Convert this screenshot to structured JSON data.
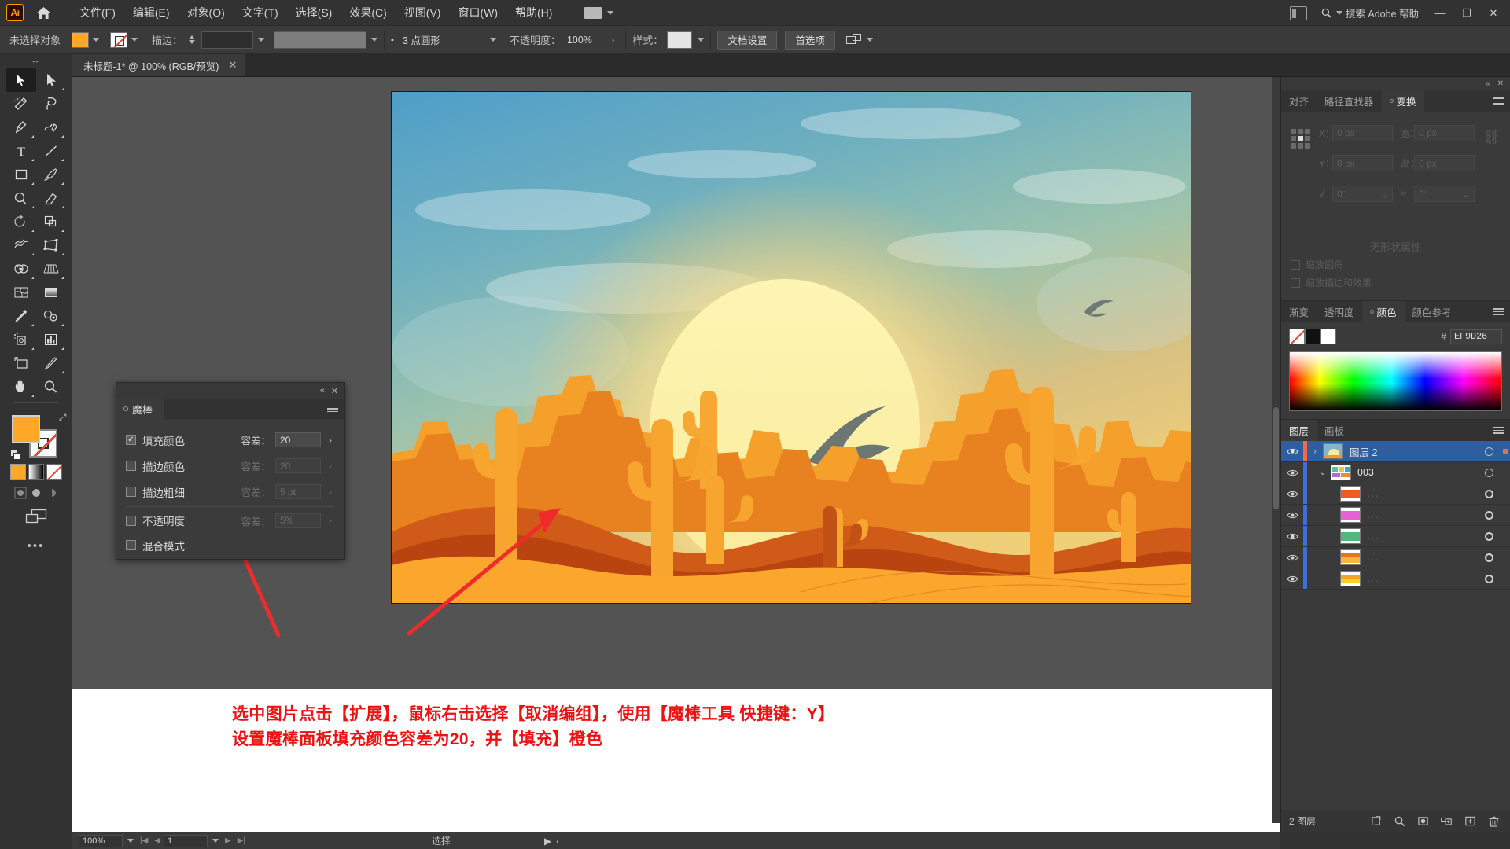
{
  "app": {
    "logo_text": "Ai",
    "home_icon": "home-icon"
  },
  "menubar": {
    "items": [
      {
        "label": "文件(F)"
      },
      {
        "label": "编辑(E)"
      },
      {
        "label": "对象(O)"
      },
      {
        "label": "文字(T)"
      },
      {
        "label": "选择(S)"
      },
      {
        "label": "效果(C)"
      },
      {
        "label": "视图(V)"
      },
      {
        "label": "窗口(W)"
      },
      {
        "label": "帮助(H)"
      }
    ],
    "search_placeholder": "搜索 Adobe 帮助",
    "minimize": "—",
    "restore": "❐",
    "close": "✕"
  },
  "controlbar": {
    "selection_status": "未选择对象",
    "fill_color": "#FFA727",
    "stroke_label": "描边：",
    "stroke_weight": "",
    "stroke_profile_label": "3 点圆形",
    "opacity_label": "不透明度：",
    "opacity_value": "100%",
    "style_label": "样式：",
    "doc_setup_label": "文档设置",
    "preferences_label": "首选项",
    "arrange_icon": "arrange-documents-icon"
  },
  "document_tab": {
    "title": "未标题-1* @ 100% (RGB/预览)",
    "close": "✕"
  },
  "toolbar": {
    "tools": [
      {
        "name": "selection-tool",
        "active": true
      },
      {
        "name": "direct-selection-tool",
        "active": false
      },
      {
        "name": "magic-wand-tool",
        "active": false
      },
      {
        "name": "lasso-tool",
        "active": false
      },
      {
        "name": "pen-tool",
        "active": false
      },
      {
        "name": "curvature-tool",
        "active": false
      },
      {
        "name": "type-tool",
        "active": false
      },
      {
        "name": "line-segment-tool",
        "active": false
      },
      {
        "name": "rectangle-tool",
        "active": false
      },
      {
        "name": "paintbrush-tool",
        "active": false
      },
      {
        "name": "shaper-tool",
        "active": false
      },
      {
        "name": "eraser-tool",
        "active": false
      },
      {
        "name": "rotate-tool",
        "active": false
      },
      {
        "name": "scale-tool",
        "active": false
      },
      {
        "name": "width-tool",
        "active": false
      },
      {
        "name": "free-transform-tool",
        "active": false
      },
      {
        "name": "shape-builder-tool",
        "active": false
      },
      {
        "name": "perspective-grid-tool",
        "active": false
      },
      {
        "name": "mesh-tool",
        "active": false
      },
      {
        "name": "gradient-tool",
        "active": false
      },
      {
        "name": "eyedropper-tool",
        "active": false
      },
      {
        "name": "blend-tool",
        "active": false
      },
      {
        "name": "symbol-sprayer-tool",
        "active": false
      },
      {
        "name": "column-graph-tool",
        "active": false
      },
      {
        "name": "artboard-tool",
        "active": false
      },
      {
        "name": "slice-tool",
        "active": false
      },
      {
        "name": "hand-tool",
        "active": false
      },
      {
        "name": "zoom-tool",
        "active": false
      }
    ],
    "fill_color": "#FFA727",
    "stroke_color": "none",
    "more_tools": "•••"
  },
  "wand_panel": {
    "tab_label": "魔棒",
    "collapse_icon": "collapse-icon",
    "close_icon": "close-icon",
    "menu_icon": "panel-menu-icon",
    "rows": [
      {
        "label": "填充颜色",
        "checked": true,
        "tol_label": "容差：",
        "tol_value": "20",
        "enabled": true
      },
      {
        "label": "描边颜色",
        "checked": false,
        "tol_label": "容差：",
        "tol_value": "20",
        "enabled": false
      },
      {
        "label": "描边粗细",
        "checked": false,
        "tol_label": "容差：",
        "tol_value": "5 pt",
        "enabled": false
      },
      {
        "label": "不透明度",
        "checked": false,
        "tol_label": "容差：",
        "tol_value": "5%",
        "enabled": false
      },
      {
        "label": "混合模式",
        "checked": false,
        "tol_label": "",
        "tol_value": "",
        "enabled": false
      }
    ]
  },
  "transform_panel": {
    "tabs": [
      {
        "label": "对齐",
        "active": false
      },
      {
        "label": "路径查找器",
        "active": false
      },
      {
        "label": "变换",
        "active": true
      }
    ],
    "fields": [
      {
        "key": "X：",
        "value": "0 px"
      },
      {
        "key": "宽：",
        "value": "0 px"
      },
      {
        "key": "Y：",
        "value": "0 px"
      },
      {
        "key": "高：",
        "value": "0 px"
      }
    ],
    "angle_value": "0°",
    "shear_value": "0°",
    "no_properties": "无形状属性",
    "check_scale_corners": "缩放圆角",
    "check_scale_strokes": "缩放描边和效果"
  },
  "color_panel": {
    "tabs": [
      {
        "label": "渐变",
        "active": false
      },
      {
        "label": "透明度",
        "active": false
      },
      {
        "label": "颜色",
        "active": true
      },
      {
        "label": "颜色参考",
        "active": false
      }
    ],
    "hash": "#",
    "hex_value": "EF9D26",
    "swatch_none": "none",
    "swatch_black": "#111111",
    "swatch_white": "#FFFFFF"
  },
  "layers_panel": {
    "tabs": [
      {
        "label": "图层",
        "active": true
      },
      {
        "label": "画板",
        "active": false
      }
    ],
    "rows": [
      {
        "name": "图层 2",
        "selected": true,
        "indent": 0,
        "twisty": "›",
        "color": "#f06a4b",
        "thumb": "sunset",
        "target": "ring"
      },
      {
        "name": "003",
        "selected": false,
        "indent": 0,
        "twisty": "⌄",
        "color": "#3d6fd4",
        "thumb": "group",
        "target": "ring"
      },
      {
        "name": "...",
        "selected": false,
        "indent": 1,
        "twisty": "",
        "color": "#3d6fd4",
        "thumb": "red",
        "target": "ring2"
      },
      {
        "name": "...",
        "selected": false,
        "indent": 1,
        "twisty": "",
        "color": "#3d6fd4",
        "thumb": "magenta",
        "target": "ring2"
      },
      {
        "name": "...",
        "selected": false,
        "indent": 1,
        "twisty": "",
        "color": "#3d6fd4",
        "thumb": "green",
        "target": "ring2"
      },
      {
        "name": "...",
        "selected": false,
        "indent": 1,
        "twisty": "",
        "color": "#3d6fd4",
        "thumb": "orange",
        "target": "ring2"
      },
      {
        "name": "...",
        "selected": false,
        "indent": 1,
        "twisty": "",
        "color": "#3d6fd4",
        "thumb": "yellow",
        "target": "ring2"
      }
    ],
    "footer_count": "2 图层",
    "footer_buttons": [
      {
        "name": "locate-object-button",
        "icon": "locate-icon"
      },
      {
        "name": "search-layer-button",
        "icon": "search-icon"
      },
      {
        "name": "make-clipping-mask-button",
        "icon": "mask-icon"
      },
      {
        "name": "create-sublayer-button",
        "icon": "sublayer-icon"
      },
      {
        "name": "create-layer-button",
        "icon": "plus-icon"
      },
      {
        "name": "delete-layer-button",
        "icon": "trash-icon"
      }
    ]
  },
  "statusbar": {
    "zoom_value": "100%",
    "page_value": "1",
    "status_label": "选择",
    "nav_first": "|◀",
    "nav_prev": "◀",
    "nav_next": "▶",
    "nav_last": "▶|"
  },
  "annotation": {
    "line1": "选中图片点击【扩展】，鼠标右击选择【取消编组】，使用【魔棒工具 快捷键：Y】",
    "line2": "设置魔棒面板填充颜色容差为20，并【填充】橙色",
    "color": "#EE1111"
  },
  "artwork": {
    "title": "desert-sunset-illustration",
    "colors": {
      "sky_top": "#4e9ec8",
      "sky_mid": "#8fbfb8",
      "sky_warm": "#e8c87a",
      "sun": "#fbf0a8",
      "mesa_dark": "#e06a1e",
      "mesa_mid": "#f08a22",
      "cactus": "#f59a2a",
      "dune_dark": "#c44a16",
      "dune_front": "#fba62c",
      "bird": "#6e7a74"
    }
  }
}
